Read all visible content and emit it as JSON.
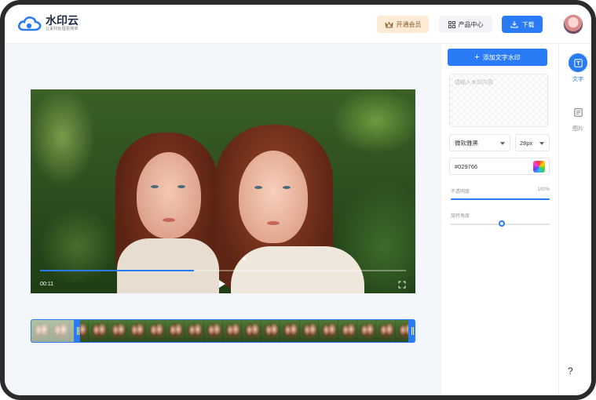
{
  "app": {
    "name": "水印云",
    "slogan": "让素材处理更简单",
    "brand_color": "#2a7cf6"
  },
  "header": {
    "vip_label": "开通会员",
    "vip_icon": "crown-icon",
    "products_label": "产品中心",
    "products_icon": "grid-icon",
    "download_label": "下载",
    "download_icon": "download-icon"
  },
  "video": {
    "current_time": "00:11",
    "progress": 0.42
  },
  "panel": {
    "add_text_watermark": "添加文字水印",
    "watermark_placeholder": "请输入水印内容",
    "font_family": "微软雅黑",
    "font_size": "28px",
    "color_value": "#029766",
    "opacity_label": "不透明度",
    "opacity_value": "100%",
    "rotation_label": "旋转角度"
  },
  "side_tabs": [
    {
      "label": "文字",
      "icon": "text-icon"
    },
    {
      "label": "图片",
      "icon": "image-icon"
    }
  ],
  "help_label": "?"
}
